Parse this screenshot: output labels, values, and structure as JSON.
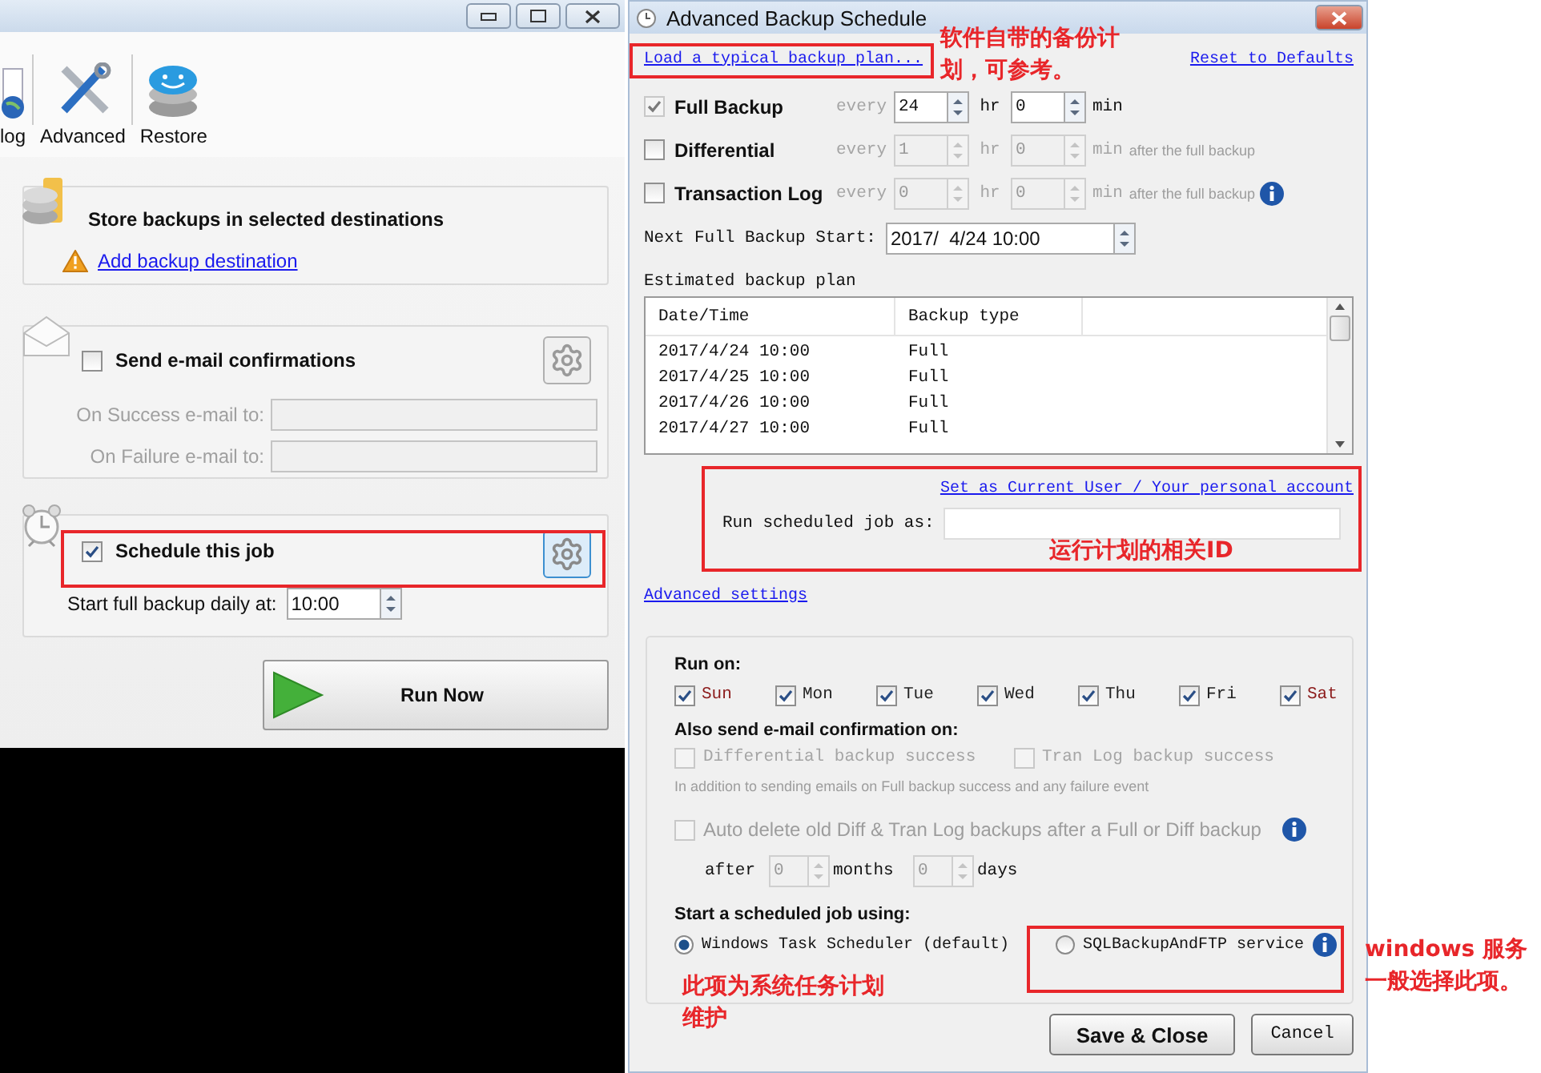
{
  "main_window": {
    "toolbar": [
      {
        "label": "log",
        "kind": "log"
      },
      {
        "label": "Advanced",
        "kind": "tools"
      },
      {
        "label": "Restore",
        "kind": "restore"
      }
    ],
    "destinations": {
      "title": "Store backups in selected destinations",
      "link": "Add backup destination"
    },
    "email": {
      "label": "Send e-mail confirmations",
      "checked": false,
      "fields": [
        {
          "label": "On Success e-mail to:"
        },
        {
          "label": "On Failure e-mail to:"
        }
      ]
    },
    "schedule": {
      "label": "Schedule this job",
      "checked": true,
      "time_label": "Start full backup daily at:",
      "time": "10:00"
    },
    "run_button": "Run Now"
  },
  "dialog": {
    "title": "Advanced Backup Schedule",
    "load_link": "Load a typical backup plan...",
    "reset_link": "Reset to Defaults",
    "backups": [
      {
        "name": "Full Backup",
        "checked": true,
        "locked": true,
        "enabled": true,
        "every": "every",
        "hours": "24",
        "hr": "hr",
        "minutes": "0",
        "min": "min"
      },
      {
        "name": "Differential",
        "checked": false,
        "locked": false,
        "enabled": false,
        "every": "every",
        "hours": "1",
        "hr": "hr",
        "minutes": "0",
        "min": "min",
        "note": "after the full backup"
      },
      {
        "name": "Transaction Log",
        "checked": false,
        "locked": false,
        "enabled": false,
        "every": "every",
        "hours": "0",
        "hr": "hr",
        "minutes": "0",
        "min": "min",
        "note": "after the full backup",
        "info": true
      }
    ],
    "next_start": {
      "label": "Next Full Backup Start:",
      "value": "2017/  4/24 10:00"
    },
    "plan": {
      "title": "Estimated backup plan",
      "columns": [
        "Date/Time",
        "Backup type"
      ],
      "rows": [
        [
          "2017/4/24 10:00",
          "Full"
        ],
        [
          "2017/4/25 10:00",
          "Full"
        ],
        [
          "2017/4/26 10:00",
          "Full"
        ],
        [
          "2017/4/27 10:00",
          "Full"
        ]
      ]
    },
    "run_as": {
      "link": "Set as Current User / Your personal account",
      "label": "Run scheduled job as:"
    },
    "advanced_link": "Advanced settings",
    "run_on": {
      "title": "Run on:",
      "days": [
        {
          "label": "Sun",
          "checked": true,
          "color": "#8b1a1a"
        },
        {
          "label": "Mon",
          "checked": true,
          "color": "#222222"
        },
        {
          "label": "Tue",
          "checked": true,
          "color": "#222222"
        },
        {
          "label": "Wed",
          "checked": true,
          "color": "#222222"
        },
        {
          "label": "Thu",
          "checked": true,
          "color": "#222222"
        },
        {
          "label": "Fri",
          "checked": true,
          "color": "#222222"
        },
        {
          "label": "Sat",
          "checked": true,
          "color": "#8b1a1a"
        }
      ]
    },
    "also_email": {
      "title": "Also send e-mail confirmation on:",
      "options": [
        {
          "label": "Differential backup success",
          "checked": false,
          "disabled": true
        },
        {
          "label": "Tran Log backup success",
          "checked": false,
          "disabled": true
        }
      ],
      "note": "In addition to sending emails on Full backup success and any failure event"
    },
    "auto_delete": {
      "label": "Auto delete old Diff & Tran Log backups after a Full or Diff backup",
      "checked": false,
      "disabled": true,
      "after": "after",
      "months": "0",
      "months_label": "months",
      "days": "0",
      "days_label": "days"
    },
    "start_using": {
      "title": "Start a scheduled job using:",
      "options": [
        {
          "label": "Windows Task Scheduler (default)",
          "selected": true
        },
        {
          "label": "SQLBackupAndFTP service",
          "selected": false,
          "info": true
        }
      ]
    },
    "buttons": [
      {
        "label": "Save & Close",
        "kind": "primary"
      },
      {
        "label": "Cancel",
        "kind": "secondary"
      }
    ]
  },
  "annotations": [
    {
      "text": "软件自带的备份计划，可参考。"
    },
    {
      "text": "运行计划的相关ID"
    },
    {
      "text": "此项为系统任务计划维护"
    },
    {
      "text": "windows 服务一般选择此项。"
    }
  ]
}
